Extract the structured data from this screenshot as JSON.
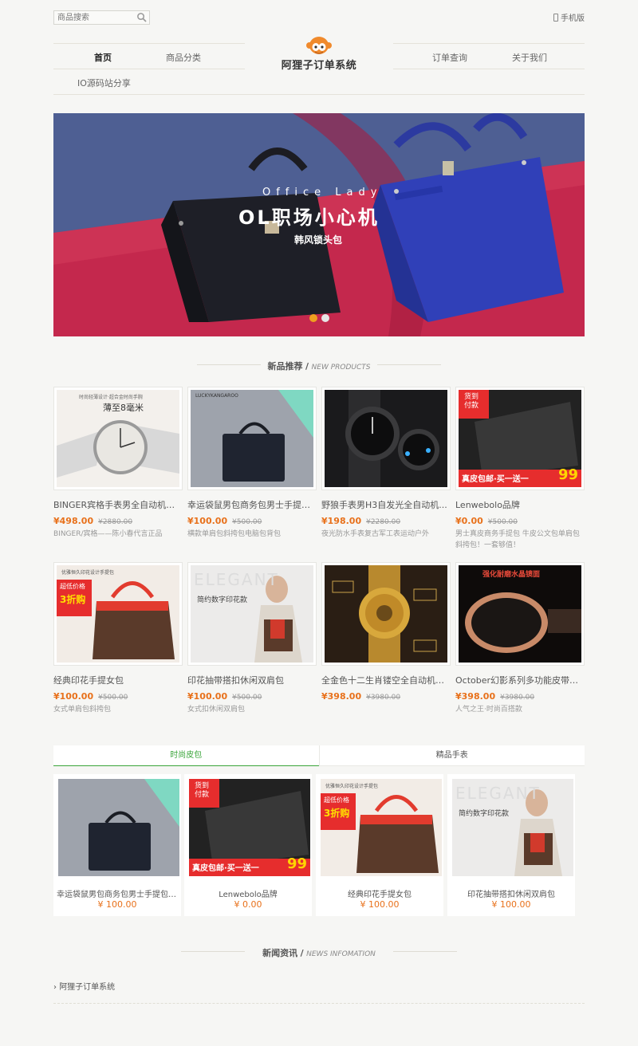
{
  "header": {
    "search_placeholder": "商品搜索",
    "mobile_label": "手机版",
    "logo_text": "阿狸子订单系统"
  },
  "nav": {
    "items": [
      {
        "label": "首页"
      },
      {
        "label": "商品分类"
      },
      {
        "label": "订单查询"
      },
      {
        "label": "关于我们"
      },
      {
        "label": "IO源码站分享"
      }
    ]
  },
  "banner": {
    "subtitle": "Office Lady",
    "title": "OL职场小心机",
    "tagline": "韩风锁头包",
    "dot_colors": [
      "#f0a020",
      "#e6e6e6"
    ]
  },
  "sections": {
    "new_products": {
      "cn": "新品推荐",
      "sep": "/",
      "en": "NEW PRODUCTS"
    },
    "news": {
      "cn": "新闻资讯",
      "sep": "/",
      "en": "NEWS INFOMATION"
    }
  },
  "products": [
    {
      "name": "BINGER宾格手表男全自动机械表",
      "price": "¥498.00",
      "old": "¥2880.00",
      "desc": "BINGER/宾格——陈小春代言正品",
      "img_text": "薄至8毫米",
      "img_top": "时尚轻薄设计·超合金时尚手腕"
    },
    {
      "name": "幸运袋鼠男包商务包男士手提包...",
      "price": "¥100.00",
      "old": "¥500.00",
      "desc": "横款单肩包斜挎包电脑包背包",
      "img_top": "LUCKYKANGAROO"
    },
    {
      "name": "野狼手表男H3自发光全自动机...",
      "price": "¥198.00",
      "old": "¥2280.00",
      "desc": "夜光防水手表复古军工表运动户外"
    },
    {
      "name": "Lenwebolo品牌",
      "price": "¥0.00",
      "old": "¥500.00",
      "desc": "男士真皮商务手提包 牛皮公文包单肩包斜挎包！一套够值！",
      "img_badge": "货到付款",
      "img_banner": "真皮包邮·买一送一",
      "img_num": "99"
    },
    {
      "name": "经典印花手提女包",
      "price": "¥100.00",
      "old": "¥500.00",
      "desc": "女式单肩包斜挎包",
      "img_top": "优雅恒久印花设计手提包",
      "img_badge": "超低价格",
      "img_badge2": "3折购"
    },
    {
      "name": "印花抽带搭扣休闲双肩包",
      "price": "¥100.00",
      "old": "¥500.00",
      "desc": "女式扣休闲双肩包",
      "img_top": "ELEGANT",
      "img_text": "简约数字印花款"
    },
    {
      "name": "全金色十二生肖镂空全自动机械...",
      "price": "¥398.00",
      "old": "¥3980.00",
      "desc": ""
    },
    {
      "name": "October幻影系列多功能皮带腕表",
      "price": "¥398.00",
      "old": "¥3980.00",
      "desc": "人气之王·时尚百搭款",
      "img_top": "强化耐磨水晶镜面"
    }
  ],
  "tabs": [
    {
      "label": "时尚皮包"
    },
    {
      "label": "精品手表"
    }
  ],
  "tab_items": [
    {
      "name": "幸运袋鼠男包商务包男士手提包公...",
      "price": "¥ 100.00"
    },
    {
      "name": "Lenwebolo品牌",
      "price": "¥ 0.00"
    },
    {
      "name": "经典印花手提女包",
      "price": "¥ 100.00"
    },
    {
      "name": "印花抽带搭扣休闲双肩包",
      "price": "¥ 100.00"
    }
  ],
  "news": [
    {
      "title": "阿狸子订单系统"
    }
  ],
  "colors": {
    "accent": "#e8711b",
    "tab_active": "#3aa53a",
    "background": "#f6f6f4"
  }
}
